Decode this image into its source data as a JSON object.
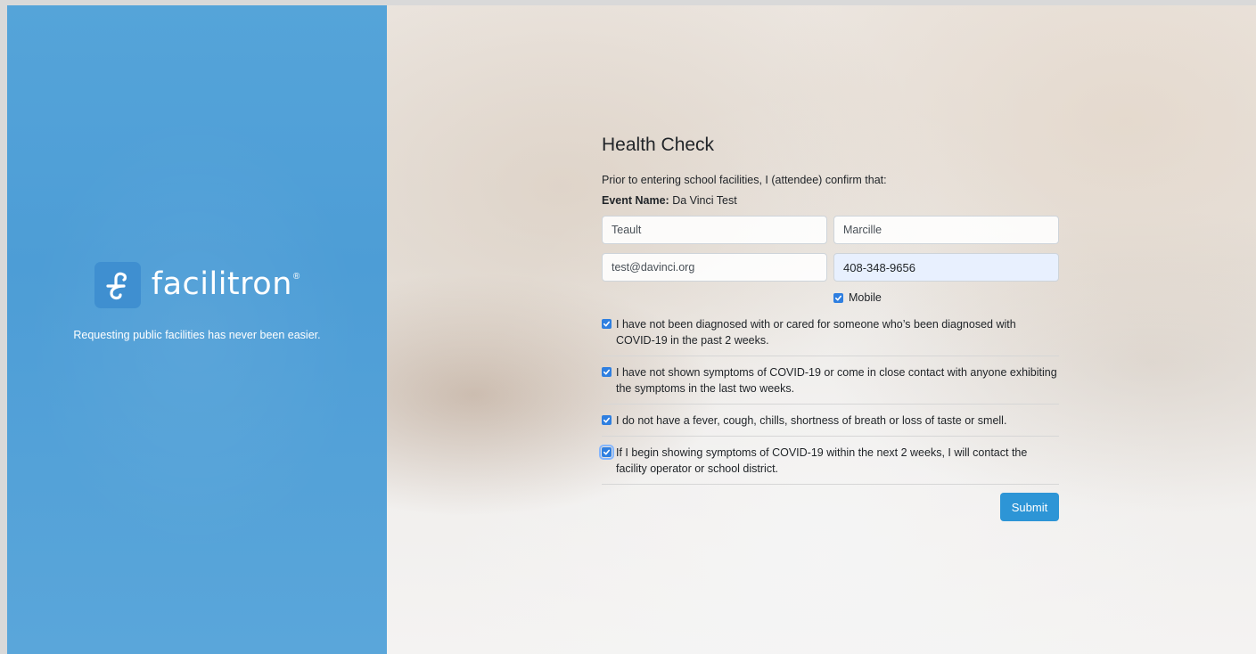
{
  "brand": {
    "name": "facilitron",
    "registered": "®",
    "tagline": "Requesting public facilities has never been easier.",
    "color": "#4d9dd6"
  },
  "form": {
    "title": "Health Check",
    "intro": "Prior to entering school facilities, I (attendee) confirm that:",
    "event_label": "Event Name:",
    "event_value": "Da Vinci Test",
    "first_name": "Teault",
    "last_name": "Marcille",
    "email": "test@davinci.org",
    "phone": "408-348-9656",
    "mobile_label": "Mobile",
    "mobile_checked": true,
    "checks": [
      {
        "text": "I have not been diagnosed with or cared for someone who’s been diagnosed with COVID-19 in the past 2 weeks.",
        "checked": true
      },
      {
        "text": "I have not shown symptoms of COVID-19 or come in close contact with anyone exhibiting the symptoms in the last two weeks.",
        "checked": true
      },
      {
        "text": "I do not have a fever, cough, chills, shortness of breath or loss of taste or smell.",
        "checked": true
      },
      {
        "text": "If I begin showing symptoms of COVID-19 within the next 2 weeks, I will contact the facility operator or school district.",
        "checked": true,
        "focused": true
      }
    ],
    "submit_label": "Submit",
    "accent_color": "#2d95d6"
  }
}
